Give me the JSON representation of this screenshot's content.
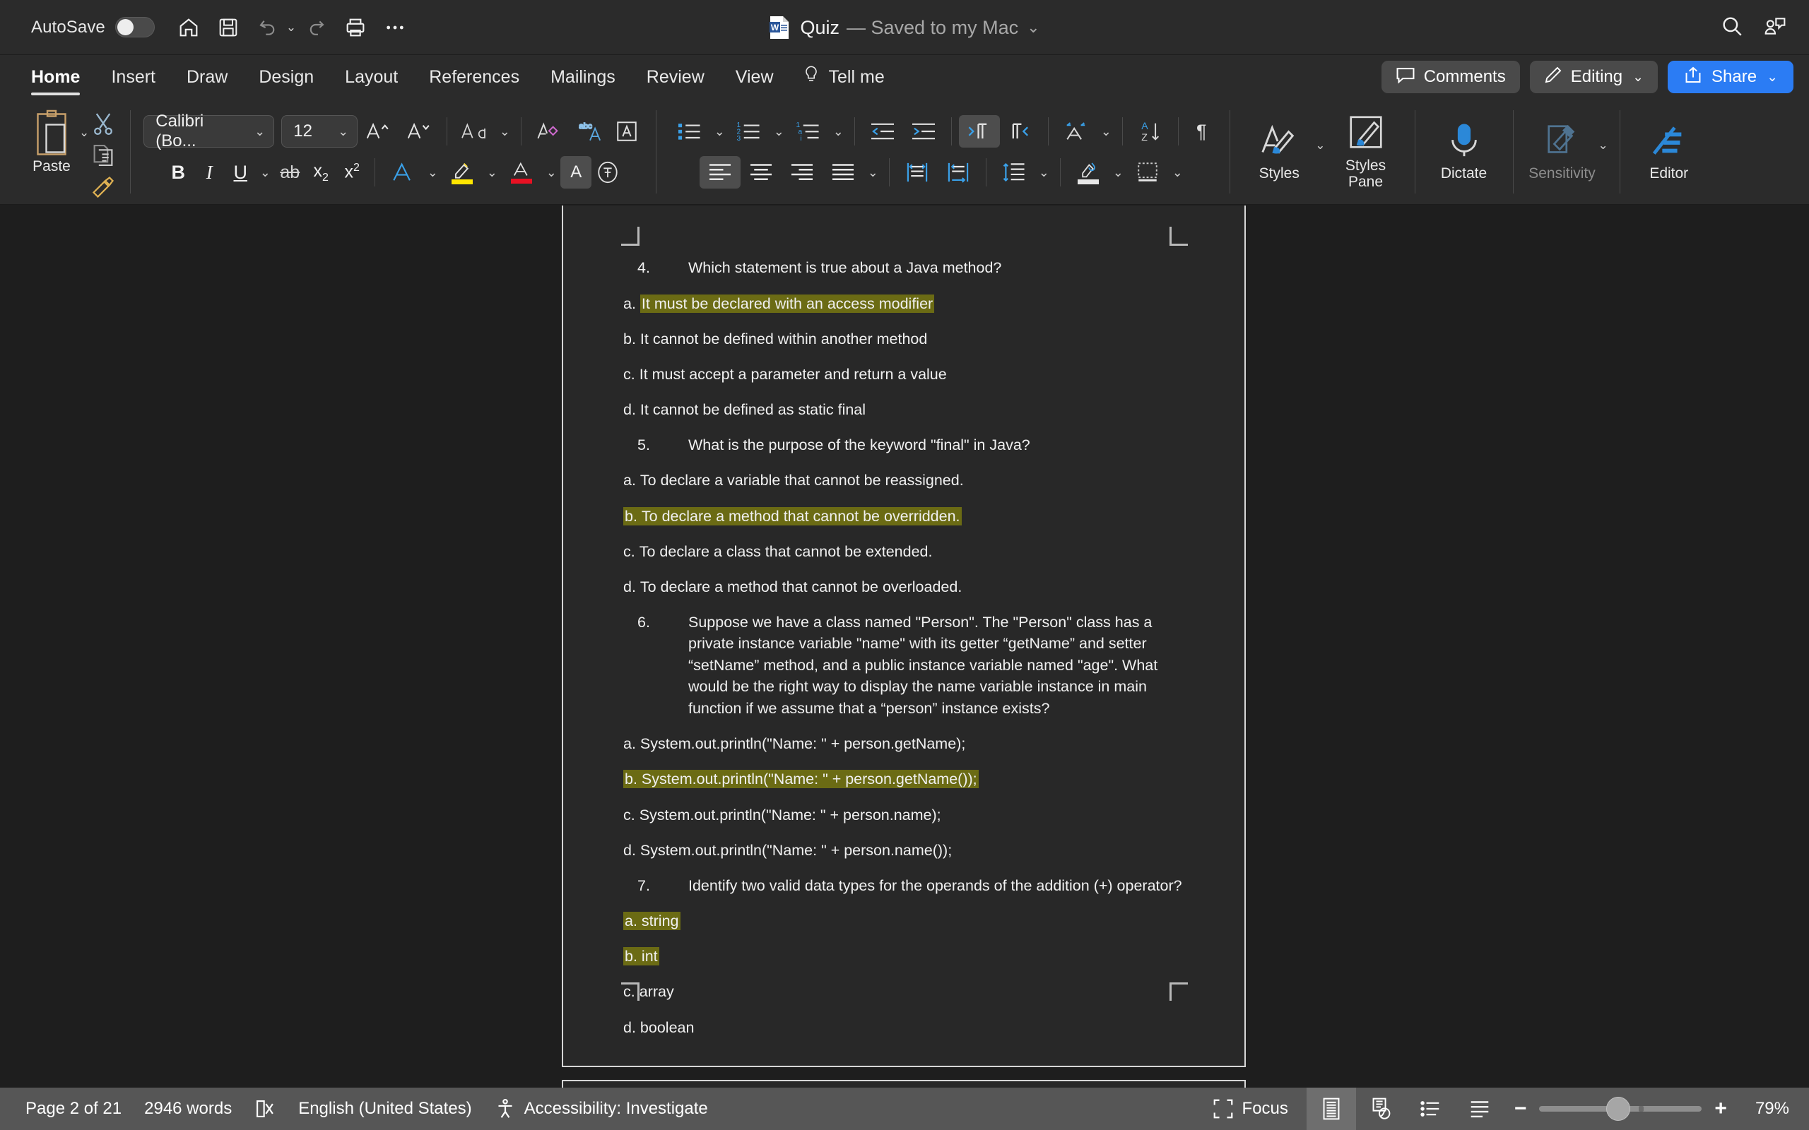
{
  "titlebar": {
    "autosave_label": "AutoSave",
    "autosave_state": "off",
    "doc_title": "Quiz",
    "doc_status": "— Saved to my Mac",
    "icons": [
      "home-icon",
      "save-icon",
      "undo-icon",
      "redo-icon",
      "print-icon",
      "more-icon"
    ],
    "right_icons": [
      "search-icon",
      "collaborator-icon"
    ]
  },
  "ribbon_tabs": {
    "tabs": [
      {
        "label": "Home",
        "active": true
      },
      {
        "label": "Insert",
        "active": false
      },
      {
        "label": "Draw",
        "active": false
      },
      {
        "label": "Design",
        "active": false
      },
      {
        "label": "Layout",
        "active": false
      },
      {
        "label": "References",
        "active": false
      },
      {
        "label": "Mailings",
        "active": false
      },
      {
        "label": "Review",
        "active": false
      },
      {
        "label": "View",
        "active": false
      }
    ],
    "tell_me": "Tell me",
    "comments": "Comments",
    "editing": "Editing",
    "share": "Share",
    "share_color": "#2b7cf4"
  },
  "ribbon": {
    "paste_label": "Paste",
    "font_name": "Calibri (Bo...",
    "font_size": "12",
    "styles_label": "Styles",
    "styles_pane_label": "Styles Pane",
    "dictate_label": "Dictate",
    "sensitivity_label": "Sensitivity",
    "editor_label": "Editor",
    "highlight_color": "#ffe600",
    "font_color": "#e81123",
    "accent_color": "#2b88d8"
  },
  "document": {
    "highlight_color": "#6b6b14",
    "blocks": [
      {
        "type": "question",
        "number": "4.",
        "text": "Which statement is true about a Java method?",
        "options": [
          {
            "label": "a.",
            "text": "It must be declared with an access modifier",
            "highlighted": true
          },
          {
            "label": "b.",
            "text": "It cannot be defined within another method",
            "highlighted": false
          },
          {
            "label": "c.",
            "text": "It must accept a parameter and return a value",
            "highlighted": false
          },
          {
            "label": "d.",
            "text": "It cannot be defined as static final",
            "highlighted": false
          }
        ]
      },
      {
        "type": "question",
        "number": "5.",
        "text": "What is the purpose of the keyword \"final\" in Java?",
        "options": [
          {
            "label": "a.",
            "text": "To declare a variable that cannot be reassigned.",
            "highlighted": false
          },
          {
            "label": "b.",
            "text": "To declare a method that cannot be overridden.",
            "highlighted": true
          },
          {
            "label": "c.",
            "text": "To declare a class that cannot be extended.",
            "highlighted": false
          },
          {
            "label": "d.",
            "text": "To declare a method that cannot be overloaded.",
            "highlighted": false
          }
        ]
      },
      {
        "type": "question",
        "number": "6.",
        "text": "Suppose we have a class named \"Person\". The \"Person\" class has a private instance variable \"name\" with its getter “getName” and setter “setName” method, and a public instance variable named \"age\".  What would be the right way to display the name variable instance in main function if we assume that a “person” instance exists?",
        "options": [
          {
            "label": "a.",
            "text": "System.out.println(\"Name: \" + person.getName);",
            "highlighted": false
          },
          {
            "label": "b.",
            "text": "System.out.println(\"Name: \" + person.getName());",
            "highlighted": true
          },
          {
            "label": "c.",
            "text": "System.out.println(\"Name: \" + person.name);",
            "highlighted": false
          },
          {
            "label": "d.",
            "text": "System.out.println(\"Name: \" + person.name());",
            "highlighted": false
          }
        ]
      },
      {
        "type": "question",
        "number": "7.",
        "text": "Identify two valid data types for the operands of the addition (+) operator?",
        "options": [
          {
            "label": "a.",
            "text": "string",
            "highlighted": true
          },
          {
            "label": "b.",
            "text": "int",
            "highlighted": true
          },
          {
            "label": "c.",
            "text": "array",
            "highlighted": false
          },
          {
            "label": "d.",
            "text": "boolean",
            "highlighted": false
          }
        ]
      }
    ]
  },
  "statusbar": {
    "page_info": "Page 2 of 21",
    "word_count": "2946 words",
    "language": "English (United States)",
    "accessibility": "Accessibility: Investigate",
    "focus": "Focus",
    "zoom": "79%",
    "zoom_minus": "−",
    "zoom_plus": "+"
  }
}
